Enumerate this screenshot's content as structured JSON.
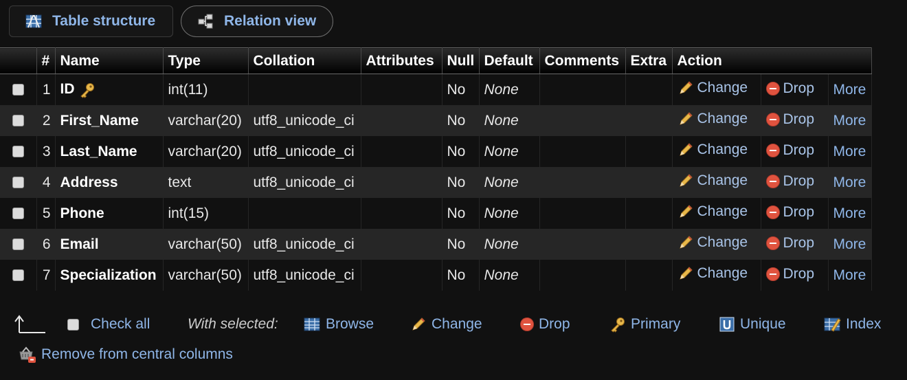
{
  "tabs": [
    {
      "label": "Table structure",
      "icon": "table-structure-icon"
    },
    {
      "label": "Relation view",
      "icon": "relation-view-icon"
    }
  ],
  "table": {
    "headers": {
      "num": "#",
      "name": "Name",
      "type": "Type",
      "collation": "Collation",
      "attributes": "Attributes",
      "null": "Null",
      "default": "Default",
      "comments": "Comments",
      "extra": "Extra",
      "action": "Action"
    },
    "rows": [
      {
        "num": "1",
        "name": "ID",
        "primary": true,
        "type": "int(11)",
        "collation": "",
        "null": "No",
        "default": "None",
        "change": "Change",
        "drop": "Drop",
        "more": "More"
      },
      {
        "num": "2",
        "name": "First_Name",
        "type": "varchar(20)",
        "collation": "utf8_unicode_ci",
        "null": "No",
        "default": "None",
        "change": "Change",
        "drop": "Drop",
        "more": "More"
      },
      {
        "num": "3",
        "name": "Last_Name",
        "type": "varchar(20)",
        "collation": "utf8_unicode_ci",
        "null": "No",
        "default": "None",
        "change": "Change",
        "drop": "Drop",
        "more": "More"
      },
      {
        "num": "4",
        "name": "Address",
        "type": "text",
        "collation": "utf8_unicode_ci",
        "null": "No",
        "default": "None",
        "change": "Change",
        "drop": "Drop",
        "more": "More"
      },
      {
        "num": "5",
        "name": "Phone",
        "type": "int(15)",
        "collation": "",
        "null": "No",
        "default": "None",
        "change": "Change",
        "drop": "Drop",
        "more": "More"
      },
      {
        "num": "6",
        "name": "Email",
        "type": "varchar(50)",
        "collation": "utf8_unicode_ci",
        "null": "No",
        "default": "None",
        "change": "Change",
        "drop": "Drop",
        "more": "More"
      },
      {
        "num": "7",
        "name": "Specialization",
        "type": "varchar(50)",
        "collation": "utf8_unicode_ci",
        "null": "No",
        "default": "None",
        "change": "Change",
        "drop": "Drop",
        "more": "More"
      }
    ]
  },
  "footer": {
    "check_all": "Check all",
    "with_selected": "With selected:",
    "browse": "Browse",
    "change": "Change",
    "drop": "Drop",
    "primary": "Primary",
    "unique": "Unique",
    "index": "Index",
    "remove_central": "Remove from central columns"
  },
  "colors": {
    "link": "#8fb6e8",
    "background": "#111111",
    "row_alt": "#262626",
    "drop": "#e0533f"
  }
}
